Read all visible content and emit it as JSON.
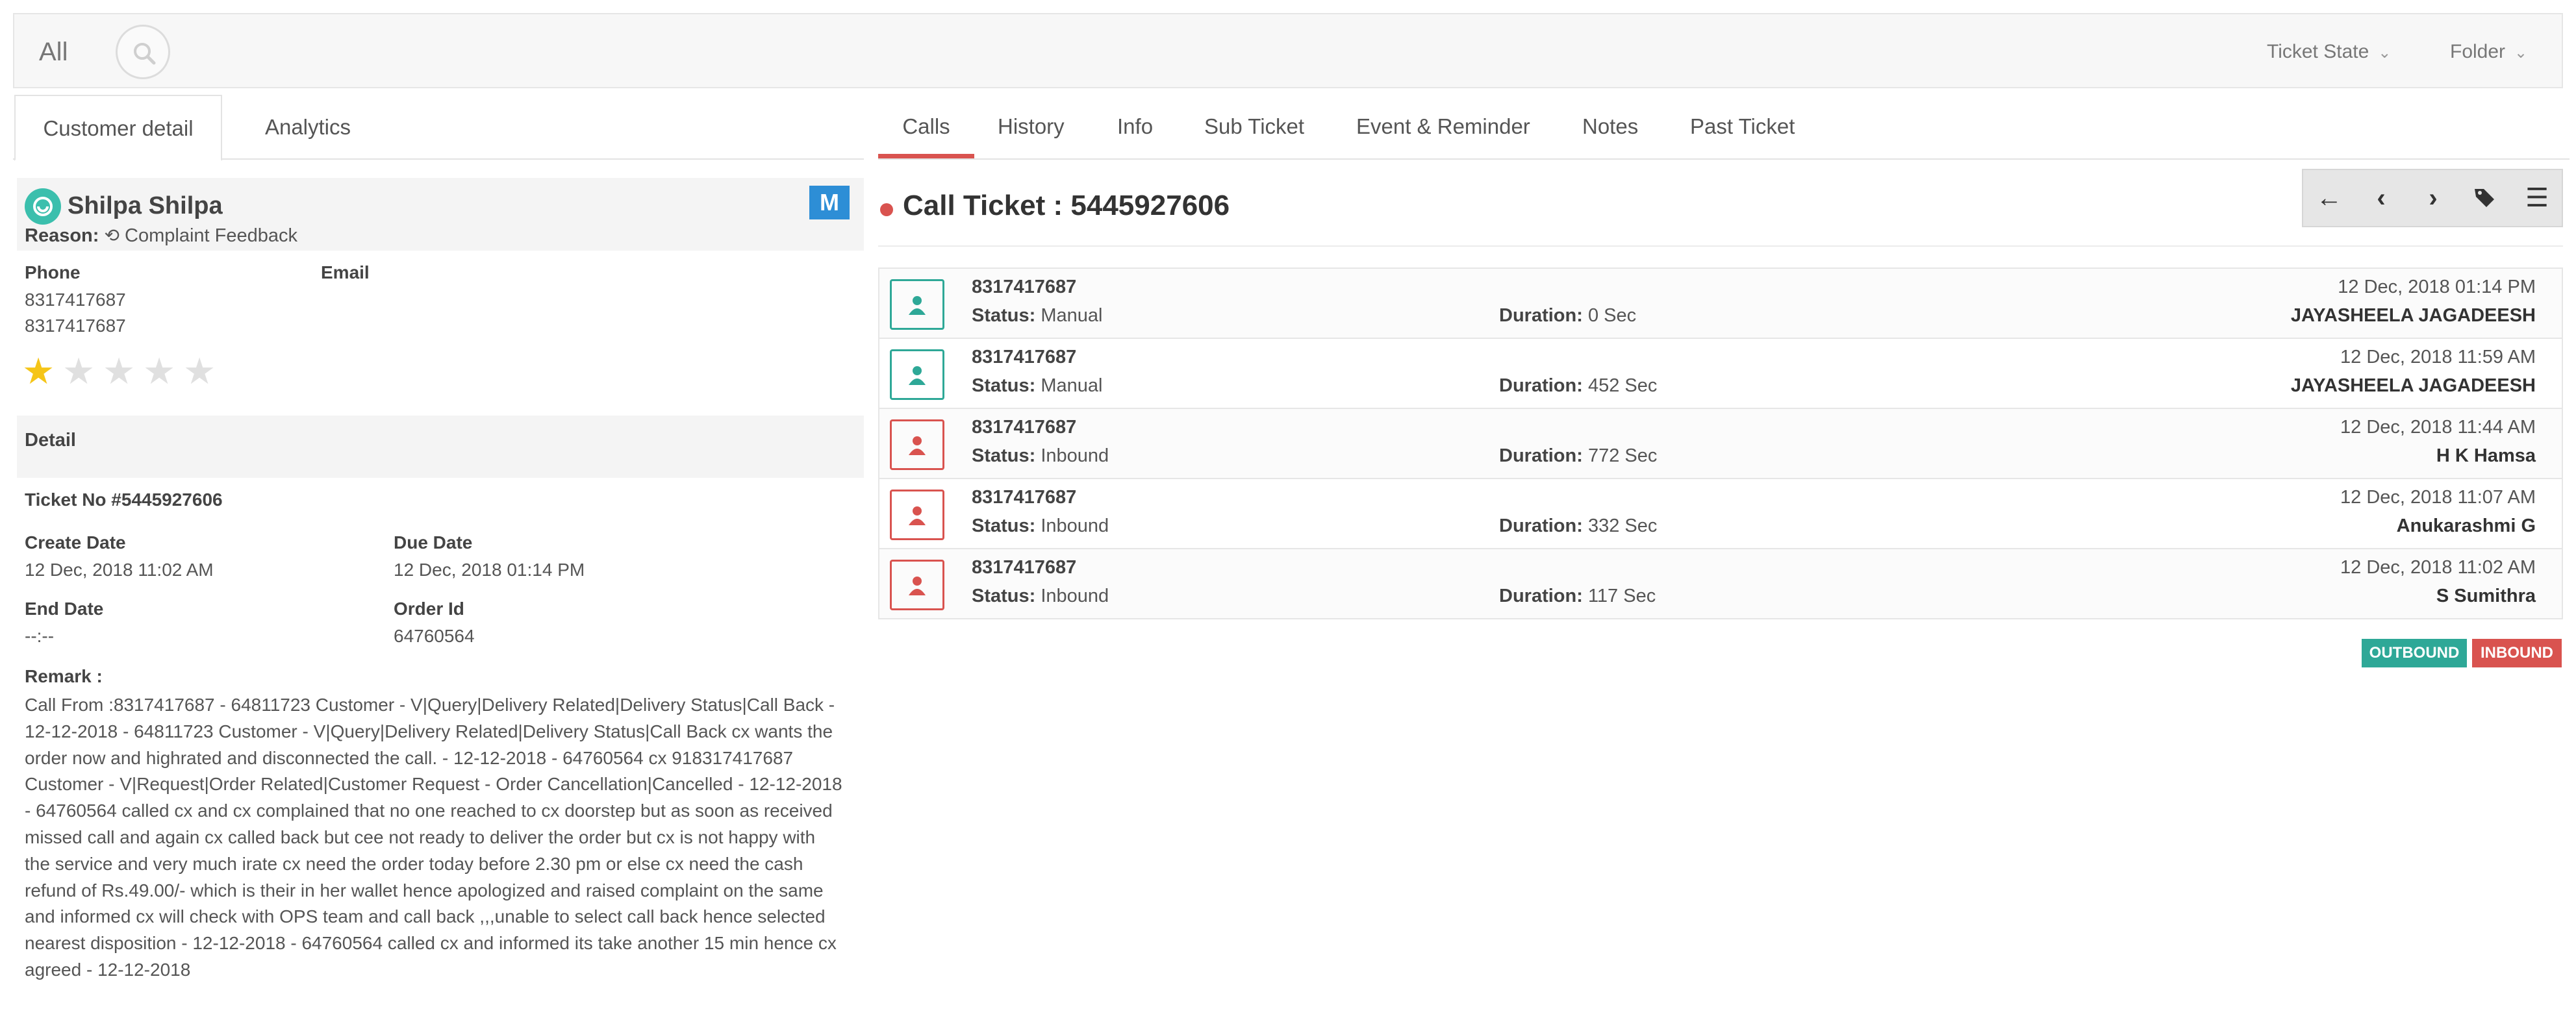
{
  "topbar": {
    "filter_label": "All",
    "ticket_state_label": "Ticket State",
    "folder_label": "Folder"
  },
  "left_tabs": [
    "Customer detail",
    "Analytics"
  ],
  "customer": {
    "name": "Shilpa Shilpa",
    "reason_label": "Reason:",
    "reason_value": "Complaint Feedback",
    "badge": "M",
    "phone_label": "Phone",
    "phones": [
      "8317417687",
      "8317417687"
    ],
    "email_label": "Email",
    "rating": 1,
    "rating_max": 5
  },
  "detail": {
    "heading": "Detail",
    "ticket_no": "Ticket No #5445927606",
    "create_date_label": "Create Date",
    "create_date": "12 Dec, 2018 11:02 AM",
    "due_date_label": "Due Date",
    "due_date": "12 Dec, 2018 01:14 PM",
    "end_date_label": "End Date",
    "end_date": "--:--",
    "order_id_label": "Order Id",
    "order_id": "64760564",
    "remark_label": "Remark :",
    "remark": "Call From :8317417687 - 64811723 Customer - V|Query|Delivery Related|Delivery Status|Call Back - 12-12-2018 - 64811723 Customer - V|Query|Delivery Related|Delivery Status|Call Back cx wants the order now and highrated and disconnected the call. - 12-12-2018 - 64760564 cx 918317417687 Customer - V|Request|Order Related|Customer Request - Order Cancellation|Cancelled - 12-12-2018 - 64760564 called cx and cx complained that no one reached to cx doorstep but as soon as received missed call and again cx called back but cee not ready to deliver the order but cx is not happy with the service and very much irate cx need the order today before 2.30 pm or else cx need the cash refund of Rs.49.00/- which is their in her wallet hence apologized and raised complaint on the same and informed cx will check with OPS team and call back ,,,unable to select call back hence selected nearest disposition - 12-12-2018 - 64760564 called cx and informed its take another 15 min hence cx agreed - 12-12-2018"
  },
  "right_tabs": [
    "Calls",
    "History",
    "Info",
    "Sub Ticket",
    "Event & Reminder",
    "Notes",
    "Past Ticket"
  ],
  "ticket": {
    "title": "Call Ticket : 5445927606"
  },
  "toolbar_icons": [
    "arrow-left-icon",
    "chevron-left-icon",
    "chevron-right-icon",
    "tags-icon",
    "menu-icon"
  ],
  "calls": [
    {
      "number": "8317417687",
      "status_label": "Status:",
      "status": "Manual",
      "duration_label": "Duration:",
      "duration": "0 Sec",
      "date": "12 Dec, 2018 01:14 PM",
      "agent": "JAYASHEELA JAGADEESH",
      "direction": "outbound"
    },
    {
      "number": "8317417687",
      "status_label": "Status:",
      "status": "Manual",
      "duration_label": "Duration:",
      "duration": "452 Sec",
      "date": "12 Dec, 2018 11:59 AM",
      "agent": "JAYASHEELA JAGADEESH",
      "direction": "outbound"
    },
    {
      "number": "8317417687",
      "status_label": "Status:",
      "status": "Inbound",
      "duration_label": "Duration:",
      "duration": "772 Sec",
      "date": "12 Dec, 2018 11:44 AM",
      "agent": "H K Hamsa",
      "direction": "inbound"
    },
    {
      "number": "8317417687",
      "status_label": "Status:",
      "status": "Inbound",
      "duration_label": "Duration:",
      "duration": "332 Sec",
      "date": "12 Dec, 2018 11:07 AM",
      "agent": "Anukarashmi G",
      "direction": "inbound"
    },
    {
      "number": "8317417687",
      "status_label": "Status:",
      "status": "Inbound",
      "duration_label": "Duration:",
      "duration": "117 Sec",
      "date": "12 Dec, 2018 11:02 AM",
      "agent": "S Sumithra",
      "direction": "inbound"
    }
  ],
  "legend": {
    "outbound": "OUTBOUND",
    "inbound": "INBOUND",
    "outbound_color": "#2ea897",
    "inbound_color": "#d9534f"
  },
  "colors": {
    "accent_red": "#d9534f",
    "accent_teal": "#2ea897",
    "badge_blue": "#2d8ed6",
    "star_gold": "#f5c518"
  }
}
